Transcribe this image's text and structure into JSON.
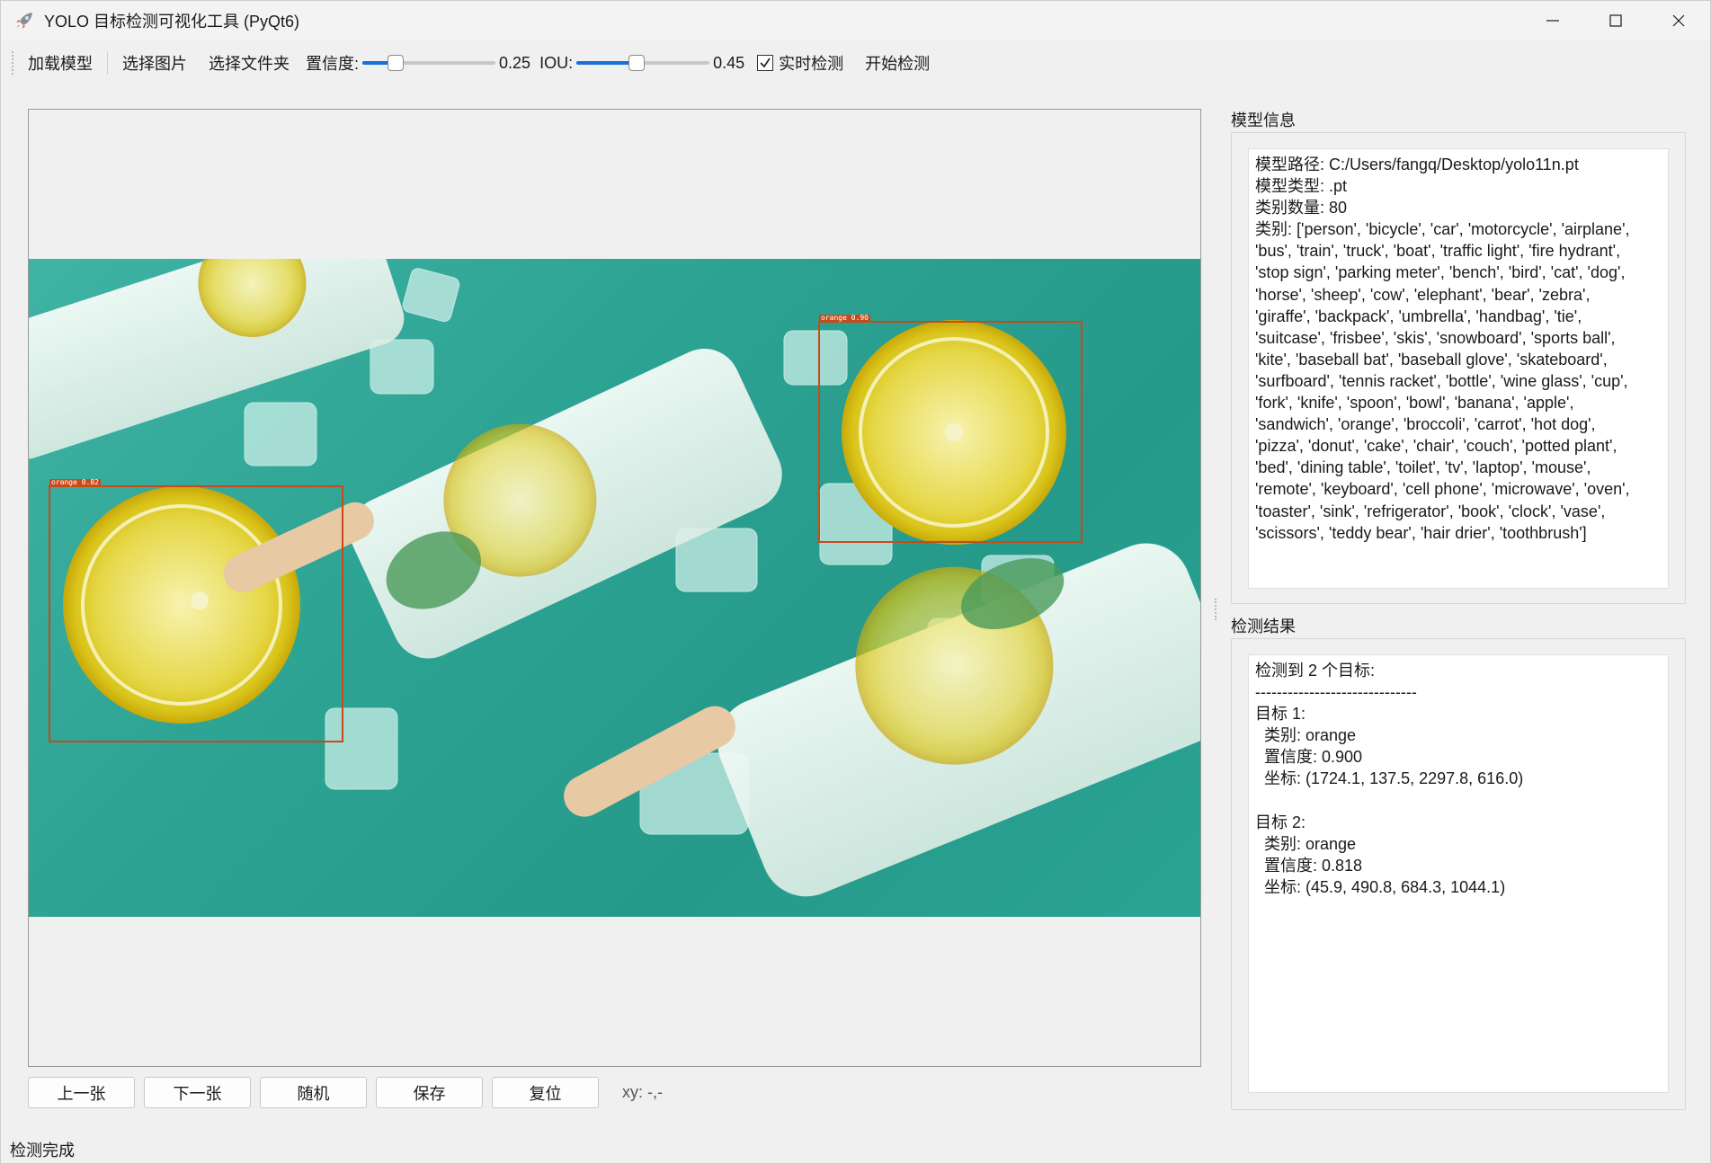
{
  "window": {
    "title": "YOLO 目标检测可视化工具 (PyQt6)",
    "controls": [
      "minimize",
      "maximize",
      "close"
    ]
  },
  "toolbar": {
    "load_model": "加载模型",
    "select_image": "选择图片",
    "select_folder": "选择文件夹",
    "confidence_label": "置信度:",
    "confidence_value": "0.25",
    "confidence_fraction": 0.25,
    "iou_label": "IOU:",
    "iou_value": "0.45",
    "iou_fraction": 0.45,
    "realtime_label": "实时检测",
    "realtime_checked": true,
    "start_detect": "开始检测"
  },
  "detections_overlay": [
    {
      "label": "orange 0.90"
    },
    {
      "label": "orange 0.82"
    }
  ],
  "nav": {
    "prev": "上一张",
    "next": "下一张",
    "random": "随机",
    "save": "保存",
    "reset": "复位",
    "xy": "xy: -,-"
  },
  "model_info": {
    "title": "模型信息",
    "text": "模型路径: C:/Users/fangq/Desktop/yolo11n.pt\n模型类型: .pt\n类别数量: 80\n类别: ['person', 'bicycle', 'car', 'motorcycle', 'airplane',\n'bus', 'train', 'truck', 'boat', 'traffic light', 'fire hydrant',\n'stop sign', 'parking meter', 'bench', 'bird', 'cat', 'dog',\n'horse', 'sheep', 'cow', 'elephant', 'bear', 'zebra',\n'giraffe', 'backpack', 'umbrella', 'handbag', 'tie',\n'suitcase', 'frisbee', 'skis', 'snowboard', 'sports ball',\n'kite', 'baseball bat', 'baseball glove', 'skateboard',\n'surfboard', 'tennis racket', 'bottle', 'wine glass', 'cup',\n'fork', 'knife', 'spoon', 'bowl', 'banana', 'apple',\n'sandwich', 'orange', 'broccoli', 'carrot', 'hot dog',\n'pizza', 'donut', 'cake', 'chair', 'couch', 'potted plant',\n'bed', 'dining table', 'toilet', 'tv', 'laptop', 'mouse',\n'remote', 'keyboard', 'cell phone', 'microwave', 'oven',\n'toaster', 'sink', 'refrigerator', 'book', 'clock', 'vase',\n'scissors', 'teddy bear', 'hair drier', 'toothbrush']"
  },
  "results": {
    "title": "检测结果",
    "text": "检测到 2 个目标:\n------------------------------\n目标 1:\n  类别: orange\n  置信度: 0.900\n  坐标: (1724.1, 137.5, 2297.8, 616.0)\n\n目标 2:\n  类别: orange\n  置信度: 0.818\n  坐标: (45.9, 490.8, 684.3, 1044.1)"
  },
  "status": "检测完成"
}
